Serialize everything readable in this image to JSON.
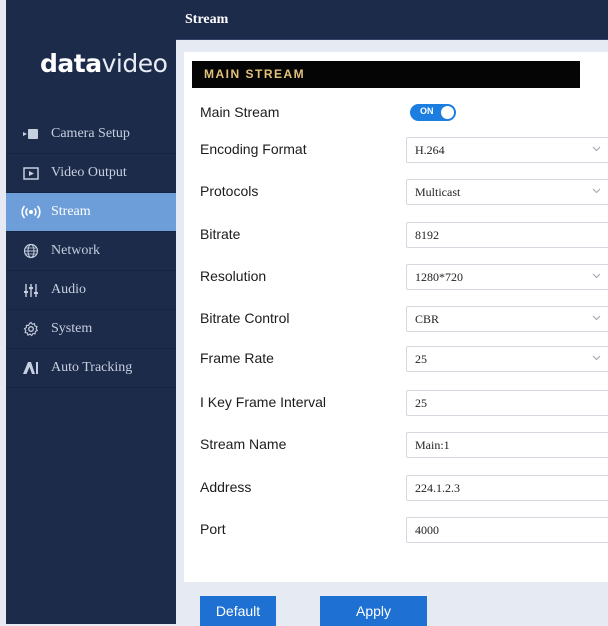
{
  "brand": {
    "bold": "data",
    "light": "video"
  },
  "header": {
    "title": "Stream"
  },
  "sidebar": {
    "items": [
      {
        "label": "Camera Setup",
        "icon": "camera-icon"
      },
      {
        "label": "Video Output",
        "icon": "video-output-icon"
      },
      {
        "label": "Stream",
        "icon": "stream-icon",
        "active": true
      },
      {
        "label": "Network",
        "icon": "globe-icon"
      },
      {
        "label": "Audio",
        "icon": "audio-sliders-icon"
      },
      {
        "label": "System",
        "icon": "gear-icon"
      },
      {
        "label": "Auto Tracking",
        "icon": "auto-tracking-icon"
      }
    ]
  },
  "section": {
    "title": "MAIN STREAM"
  },
  "form": {
    "main_stream": {
      "label": "Main Stream",
      "toggle": "ON"
    },
    "encoding_format": {
      "label": "Encoding Format",
      "value": "H.264"
    },
    "protocols": {
      "label": "Protocols",
      "value": "Multicast"
    },
    "bitrate": {
      "label": "Bitrate",
      "value": "8192"
    },
    "resolution": {
      "label": "Resolution",
      "value": "1280*720"
    },
    "bitrate_control": {
      "label": "Bitrate Control",
      "value": "CBR"
    },
    "frame_rate": {
      "label": "Frame Rate",
      "value": "25"
    },
    "key_frame_interval": {
      "label": "I Key Frame Interval",
      "value": "25"
    },
    "stream_name": {
      "label": "Stream Name",
      "value": "Main:1"
    },
    "address": {
      "label": "Address",
      "value": "224.1.2.3"
    },
    "port": {
      "label": "Port",
      "value": "4000"
    }
  },
  "buttons": {
    "default": "Default",
    "apply": "Apply"
  },
  "colors": {
    "sidebar": "#1d2b4a",
    "active": "#6d9ed9",
    "accent": "#1e71d2",
    "section_text": "#e2c27a"
  }
}
